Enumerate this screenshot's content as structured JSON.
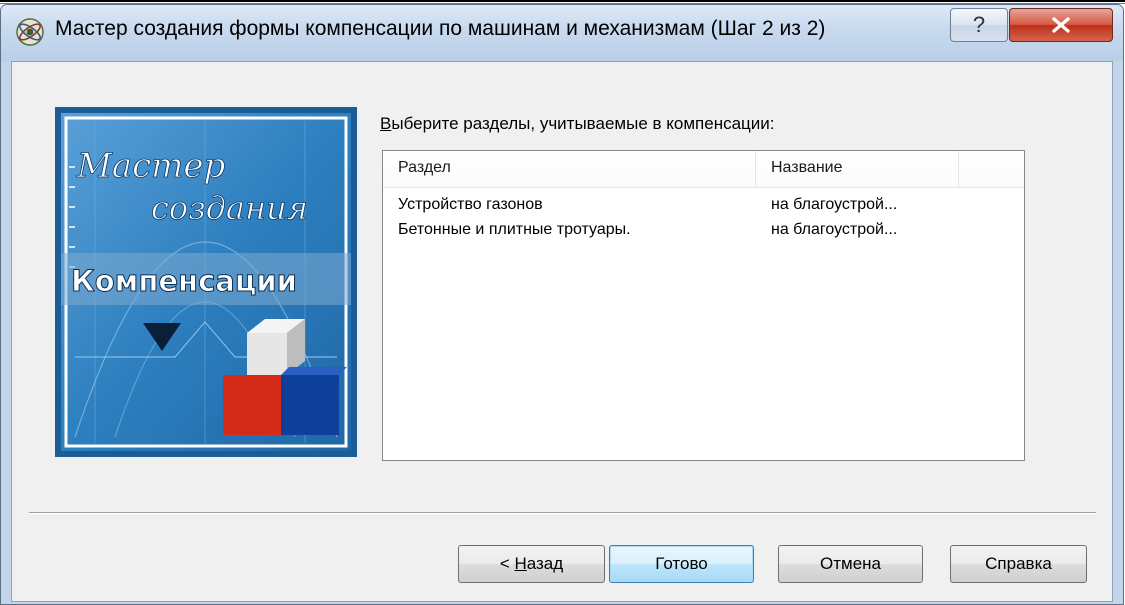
{
  "window": {
    "title": "Мастер создания формы компенсации по машинам и механизмам (Шаг 2 из 2)",
    "help_label": "?",
    "icon": "wizard-app-icon",
    "accent": "#c4d6ec"
  },
  "banner": {
    "line1": "Мастер",
    "line2": "создания",
    "line3": "Компенсации",
    "colors": {
      "background": "#2d7fbf",
      "red_cube": "#d42a18",
      "blue_cube": "#0e3f9a"
    }
  },
  "prompt": {
    "accel": "В",
    "rest": "ыберите разделы, учитываемые в компенсации:"
  },
  "list": {
    "columns": [
      "Раздел",
      "Название"
    ],
    "rows": [
      [
        "Устройство газонов",
        "на благоустрой..."
      ],
      [
        "Бетонные и плитные тротуары.",
        "на благоустрой..."
      ]
    ]
  },
  "buttons": {
    "back_prefix": "< ",
    "back_accel": "Н",
    "back_rest": "азад",
    "finish": "Готово",
    "cancel": "Отмена",
    "help": "Справка"
  }
}
